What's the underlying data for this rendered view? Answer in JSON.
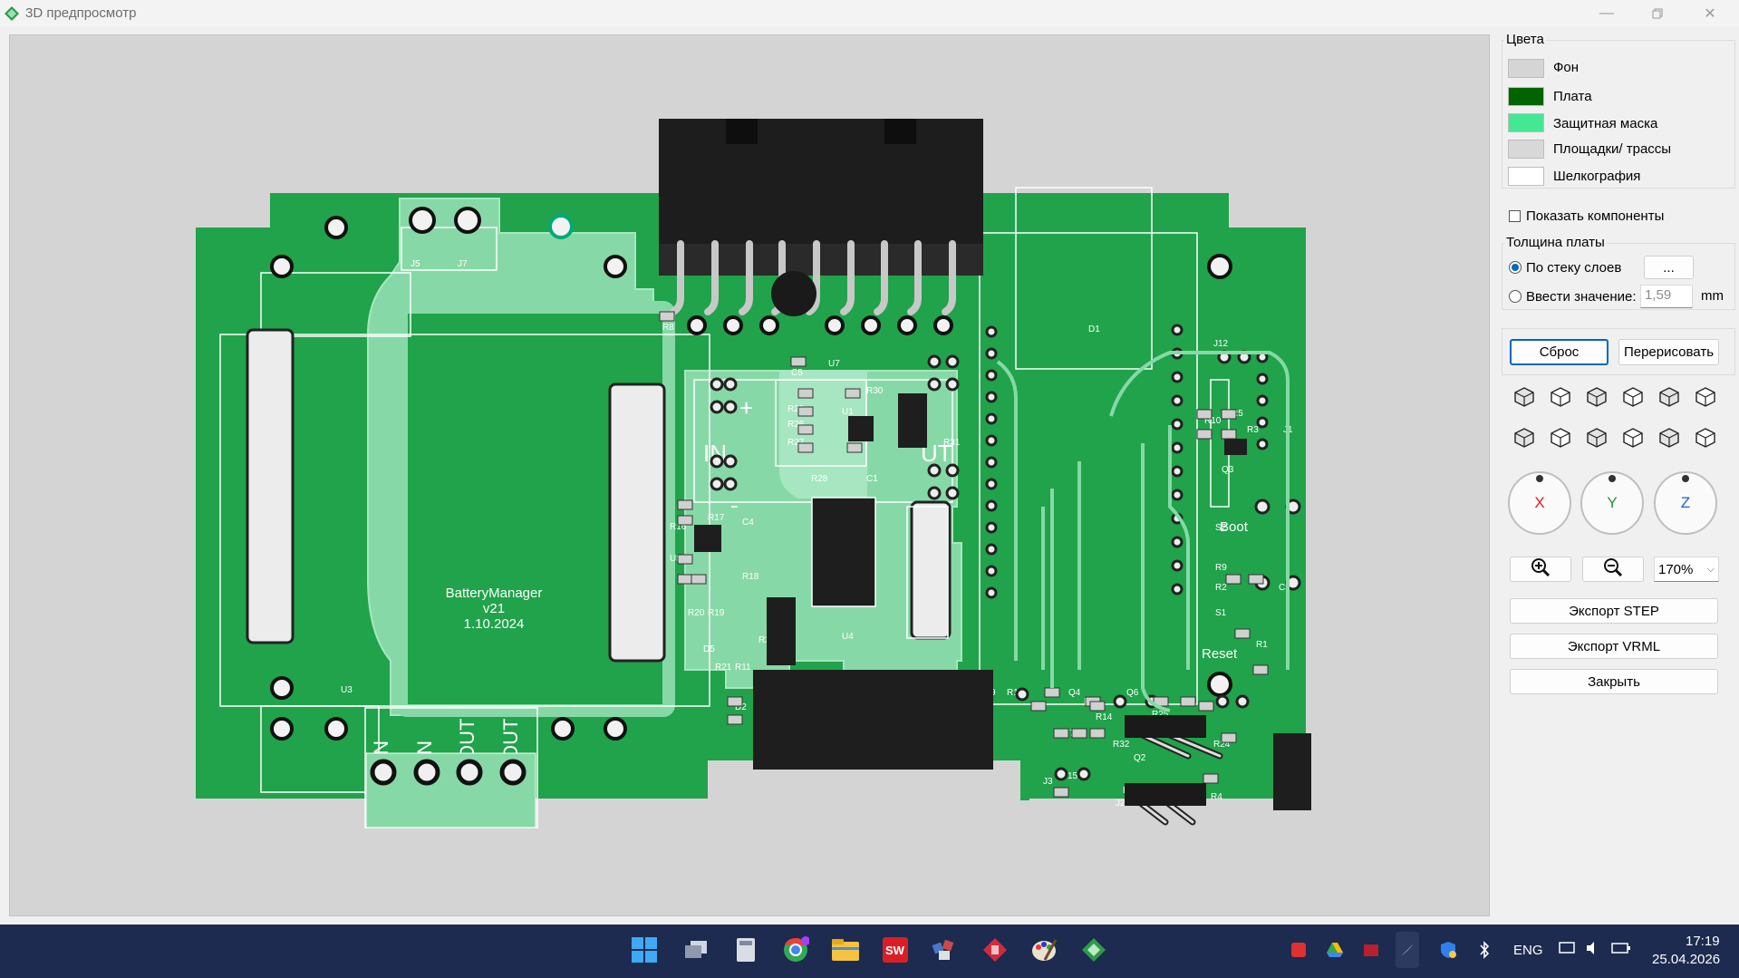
{
  "window": {
    "title": "3D предпросмотр",
    "app_icon": "kicad-logo-icon",
    "controls": [
      "minimize-icon",
      "restore-icon",
      "close-icon"
    ]
  },
  "board": {
    "silk_title": "BatteryManager",
    "silk_version": "v21",
    "silk_date": "1.10.2024",
    "label_in": "IN",
    "label_out": "UT",
    "terminal_labels": [
      "IN",
      "IN",
      "OUT",
      "OUT"
    ],
    "terminal_signs": [
      "+",
      "-",
      "-",
      "+"
    ],
    "boot_label": "Boot",
    "reset_label": "Reset",
    "refdes": [
      "J5",
      "J7",
      "R8",
      "C5",
      "U7",
      "R29",
      "U1",
      "R30",
      "R26",
      "R27",
      "R28",
      "C1",
      "R31",
      "R17",
      "R16",
      "C4",
      "U5",
      "R18",
      "R20",
      "R19",
      "D5",
      "R21",
      "R11",
      "D2",
      "R23",
      "U4",
      "U3",
      "D1",
      "J12",
      "R10",
      "R5",
      "R3",
      "Q3",
      "J1",
      "S2",
      "R9",
      "C3",
      "R2",
      "S1",
      "R1",
      "J9",
      "R13",
      "Q4",
      "Q6",
      "R6",
      "R14",
      "R25",
      "R24",
      "R7",
      "R32",
      "Q2",
      "J15",
      "R12",
      "J3",
      "J2",
      "R4"
    ],
    "colors": {
      "background": "#d4d4d4",
      "board": "#20a34a",
      "mask_pour": "#86d9a6",
      "connector": "#1a1a1a",
      "silk": "#ffffff",
      "pad": "#e0e0e0"
    }
  },
  "panel": {
    "colors_group": {
      "title": "Цвета",
      "items": [
        {
          "label": "Фон",
          "color": "#d5d5d5"
        },
        {
          "label": "Плата",
          "color": "#006400"
        },
        {
          "label": "Защитная маска",
          "color": "#44e894"
        },
        {
          "label": "Площадки/ трассы",
          "color": "#d8d8d8"
        },
        {
          "label": "Шелкография",
          "color": "#ffffff"
        }
      ]
    },
    "show_components": {
      "label": "Показать компоненты",
      "checked": false
    },
    "thickness_group": {
      "title": "Толщина платы",
      "option_stack": "По стеку слоев",
      "option_stack_selected": true,
      "stack_button": "...",
      "option_value": "Ввести значение:",
      "value": "1,59",
      "unit": "mm"
    },
    "reset_button": "Сброс",
    "redraw_button": "Перерисовать",
    "view_buttons_row1": [
      "view-iso-icon",
      "view-front-icon",
      "view-back-icon",
      "view-left-icon",
      "view-right-icon",
      "view-top-icon"
    ],
    "view_buttons_row2": [
      "view-bottom-icon",
      "view-persp-icon",
      "view-cube-icon",
      "view-cube2-icon",
      "rotate-ccw-icon",
      "rotate-cw-icon"
    ],
    "dials": [
      "X",
      "Y",
      "Z"
    ],
    "dial_colors": [
      "#e02020",
      "#1f9a3a",
      "#1f5fd0"
    ],
    "zoom_in_icon": "zoom-in-icon",
    "zoom_out_icon": "zoom-out-icon",
    "zoom_value": "170%",
    "export_step": "Экспорт STEP",
    "export_vrml": "Экспорт VRML",
    "close_button": "Закрыть"
  },
  "taskbar": {
    "apps": [
      "windows-start-icon",
      "task-view-icon",
      "calculator-icon",
      "chrome-icon",
      "file-explorer-icon",
      "solidworks-icon",
      "app-blocks-icon",
      "app-red-icon",
      "paint-icon",
      "kicad-icon"
    ],
    "tray_icons": [
      "tray-red-icon",
      "google-drive-icon",
      "tray-box-icon",
      "feather-icon",
      "shield-icon",
      "bluetooth-icon"
    ],
    "language": "ENG",
    "time": "17:19",
    "date": "25.04.2026"
  }
}
